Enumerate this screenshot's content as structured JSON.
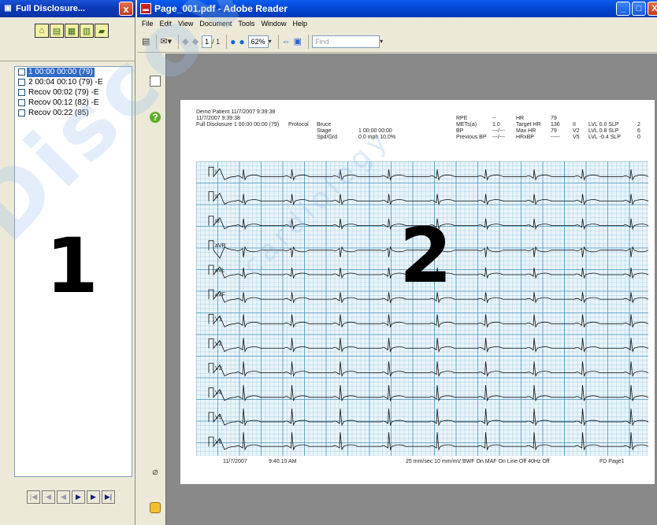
{
  "left_pane": {
    "title": "Full Disclosure...",
    "close": "x",
    "tools": [
      "house-icon",
      "print-icon",
      "screen-icon",
      "save-icon",
      "folder-icon"
    ],
    "items": [
      {
        "label": "1 00:00 00:00 (79)",
        "selected": true
      },
      {
        "label": "2 00:04 00:10 (79) -E",
        "selected": false
      },
      {
        "label": "Recov 00:02 (79) -E",
        "selected": false
      },
      {
        "label": "Recov 00:12 (82) -E",
        "selected": false
      },
      {
        "label": "Recov 00:22 (85)",
        "selected": false
      }
    ],
    "big_label": "1",
    "nav_glyphs": [
      "|◀",
      "◀",
      "◀",
      "▶",
      "▶",
      "▶|"
    ]
  },
  "reader": {
    "title": "Page_001.pdf - Adobe Reader",
    "menu": [
      "File",
      "Edit",
      "View",
      "Document",
      "Tools",
      "Window",
      "Help"
    ],
    "page_number": "1",
    "page_total": "/ 1",
    "zoom": "62%",
    "find_placeholder": "Find",
    "window_buttons": [
      "_",
      "□",
      "X"
    ]
  },
  "pdf": {
    "header_left": [
      "Demo Patient 11/7/2007 9:39:38",
      "11/7/2007 9:39:38",
      "Full Disclosure 1 00:00 00:00 (79)"
    ],
    "protocol_label": "Protocol",
    "protocol_col": [
      "Bruce",
      "Stage",
      "Spd/Grd"
    ],
    "stage_col": [
      "1 00:00 00:00",
      "0.0 mph    10.0%"
    ],
    "rpe_labels": [
      "RPE",
      "METs(a)",
      "BP",
      "Previous BP"
    ],
    "rpe_values": [
      "--",
      "1.0",
      "---/---",
      "---/---"
    ],
    "hr_labels": [
      "HR",
      "Target HR",
      "Max HR",
      "HRxBP"
    ],
    "hr_values": [
      "79",
      "136",
      "79",
      "-----"
    ],
    "lead_col": [
      "II",
      "V2",
      "V5"
    ],
    "lvl_col": [
      "LVL  0.0 SLP",
      "LVL  0.8 SLP",
      "LVL  -0.4 SLP"
    ],
    "slp_values": [
      "2",
      "6",
      "0"
    ],
    "leads": [
      "I",
      "II",
      "III",
      "aVR",
      "aVL",
      "aVF",
      "V1",
      "V2",
      "V3",
      "V4",
      "V5",
      "V6"
    ],
    "footer_date": "11/7/2007",
    "footer_time": "9:40:10 AM",
    "footer_settings": "25 mm/sec  10 mm/mV  BWF On   MAF On   Line Off  40Hz Off",
    "footer_page": "FD Page1",
    "big_label": "2"
  },
  "watermark": {
    "text": "DiscoverCardiology",
    "subtext": "cardiology"
  }
}
